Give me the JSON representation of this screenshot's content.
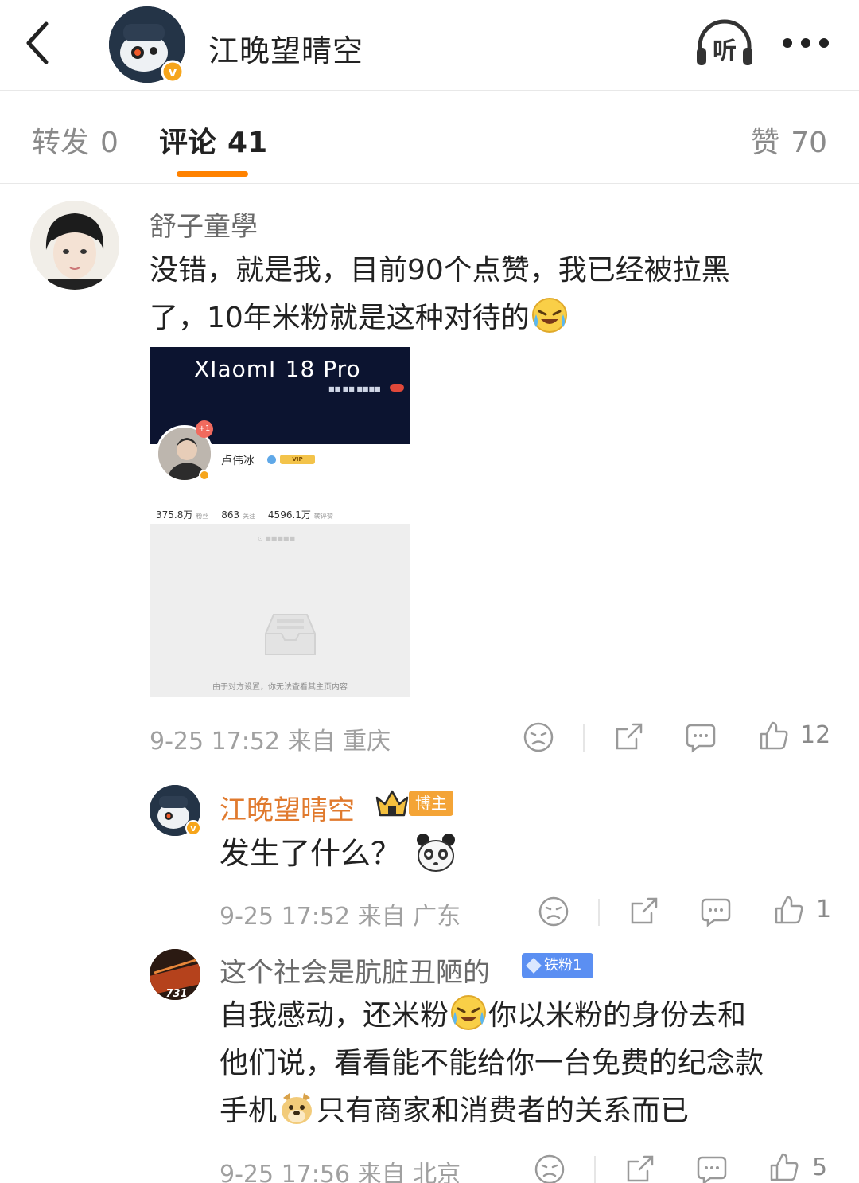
{
  "header": {
    "title": "江晚望晴空",
    "listen_label": "听"
  },
  "tabs": {
    "repost_label": "转发",
    "repost_count": "0",
    "comment_label": "评论",
    "comment_count": "41",
    "like_label": "赞",
    "like_count": "70"
  },
  "comments": [
    {
      "name": "舒子童學",
      "text_line1": "没错，就是我，目前90个点赞，我已经被拉黑",
      "text_line2": "了，10年米粉就是这种对待的",
      "image": {
        "brand": "XIaomI",
        "model": "18 Pro",
        "badge": "+1",
        "profile_name": "卢伟冰",
        "vip_label": "VIP",
        "stats": [
          {
            "value": "375.8万",
            "label": "粉丝"
          },
          {
            "value": "863",
            "label": "关注"
          },
          {
            "value": "4596.1万",
            "label": "转评赞"
          }
        ],
        "empty_caption": "由于对方设置，你无法查看其主页内容"
      },
      "meta": "9-25 17:52  来自 重庆",
      "likes": "12"
    }
  ],
  "replies": [
    {
      "name": "江晚望晴空",
      "badge": "博主",
      "text": "发生了什么？",
      "meta": "9-25 17:52  来自 广东",
      "likes": "1"
    },
    {
      "name": "这个社会是肮脏丑陋的",
      "badge": "铁粉1",
      "text_part1": "自我感动，还米粉",
      "text_part2": "你以米粉的身份去和",
      "text_line2": "他们说，看看能不能给你一台免费的纪念款",
      "text_part3": "手机",
      "text_part4": "只有商家和消费者的关系而已",
      "meta": "9-25 17:56  来自 北京",
      "likes": "5",
      "avatar_label": "731"
    }
  ],
  "colors": {
    "accent": "#ff8200",
    "blogger_name": "#e07a2e",
    "fan_badge": "#5b8ff2"
  },
  "icons": [
    "back-arrow-icon",
    "listen-icon",
    "more-icon",
    "dislike-icon",
    "share-icon",
    "comment-icon",
    "like-icon"
  ]
}
